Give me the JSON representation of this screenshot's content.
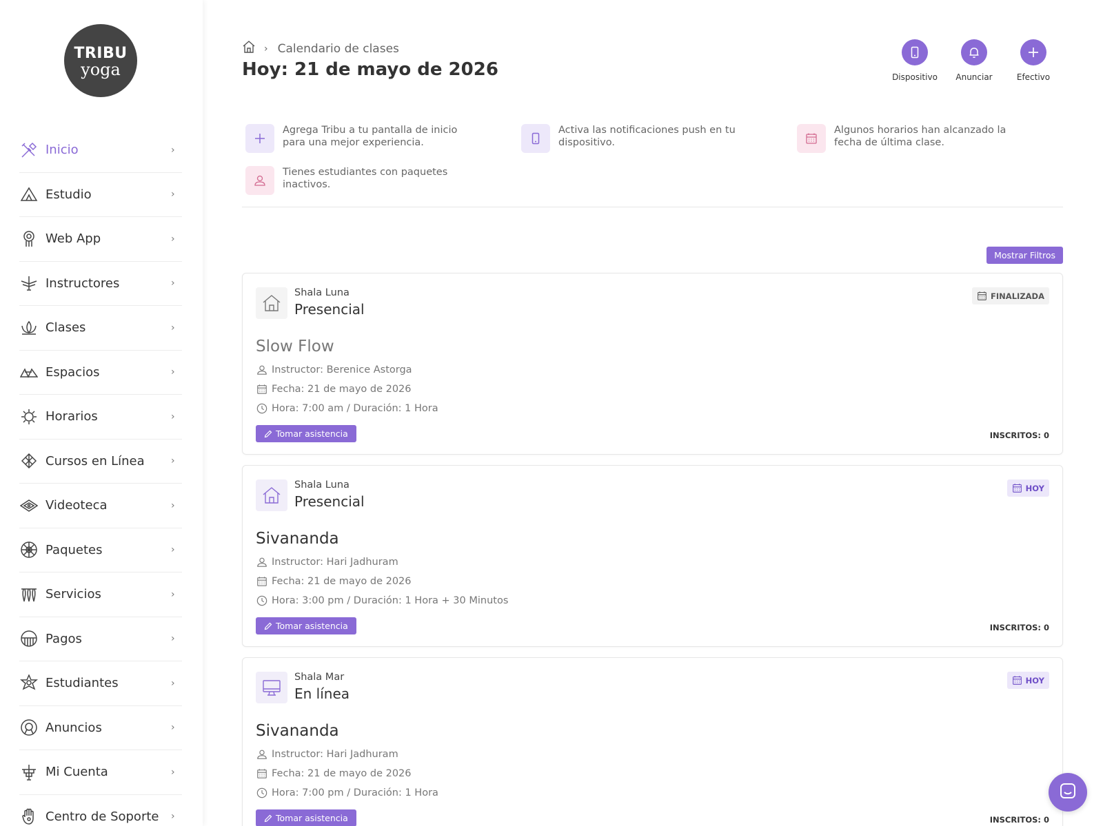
{
  "logo": {
    "line1": "TRIBU",
    "line2": "yoga"
  },
  "sidebar": {
    "items": [
      {
        "label": "Inicio",
        "icon": "sparkle-tools-icon",
        "active": true
      },
      {
        "label": "Estudio",
        "icon": "tent-icon"
      },
      {
        "label": "Web App",
        "icon": "dreamcatcher-icon"
      },
      {
        "label": "Instructores",
        "icon": "eagle-icon"
      },
      {
        "label": "Clases",
        "icon": "lotus-icon"
      },
      {
        "label": "Espacios",
        "icon": "mountains-icon"
      },
      {
        "label": "Horarios",
        "icon": "sun-icon"
      },
      {
        "label": "Cursos en Línea",
        "icon": "leaf-icon"
      },
      {
        "label": "Videoteca",
        "icon": "diamond-eye-icon"
      },
      {
        "label": "Paquetes",
        "icon": "mandala-icon"
      },
      {
        "label": "Servicios",
        "icon": "feathers-icon"
      },
      {
        "label": "Pagos",
        "icon": "half-circle-icon"
      },
      {
        "label": "Estudiantes",
        "icon": "star-person-icon"
      },
      {
        "label": "Anuncios",
        "icon": "circle-face-icon"
      },
      {
        "label": "Mi Cuenta",
        "icon": "totem-icon"
      },
      {
        "label": "Centro de Soporte",
        "icon": "hamsa-icon"
      }
    ]
  },
  "breadcrumb": {
    "current": "Calendario de clases"
  },
  "page_title": "Hoy: 21 de mayo de 2026",
  "actions": [
    {
      "label": "Dispositivo",
      "icon": "phone-icon"
    },
    {
      "label": "Anunciar",
      "icon": "bell-icon"
    },
    {
      "label": "Efectivo",
      "icon": "plus-icon"
    }
  ],
  "notices": [
    {
      "text": "Agrega Tribu a tu pantalla de inicio para una mejor experiencia.",
      "icon": "plus-icon"
    },
    {
      "text": "Activa las notificaciones push en tu dispositivo.",
      "icon": "phone-icon"
    },
    {
      "text": "Algunos horarios han alcanzado la fecha de última clase.",
      "icon": "calendar-icon"
    },
    {
      "text": "Tienes estudiantes con paquetes inactivos.",
      "icon": "user-icon"
    }
  ],
  "filters_button": "Mostrar Filtros",
  "cards": [
    {
      "space": "Shala Luna",
      "modality": "Presencial",
      "name": "Slow Flow",
      "instructor": "Instructor: Berenice Astorga",
      "date": "Fecha: 21 de mayo de 2026",
      "time": "Hora: 7:00 am / Duración: 1 Hora",
      "badge": "FINALIZADA",
      "enrolled": "INSCRITOS: 0",
      "attend": "Tomar asistencia"
    },
    {
      "space": "Shala Luna",
      "modality": "Presencial",
      "name": "Sivananda",
      "instructor": "Instructor: Hari Jadhuram",
      "date": "Fecha: 21 de mayo de 2026",
      "time": "Hora: 3:00 pm / Duración: 1 Hora + 30 Minutos",
      "badge": "HOY",
      "enrolled": "INSCRITOS: 0",
      "attend": "Tomar asistencia"
    },
    {
      "space": "Shala Mar",
      "modality": "En línea",
      "name": "Sivananda",
      "instructor": "Instructor: Hari Jadhuram",
      "date": "Fecha: 21 de mayo de 2026",
      "time": "Hora: 7:00 pm / Duración: 1 Hora",
      "badge": "HOY",
      "enrolled": "INSCRITOS: 0",
      "attend": "Tomar asistencia"
    }
  ],
  "colors": {
    "accent": "#8a6ad6",
    "pink_soft": "#fbe6ee",
    "purple_soft": "#ede8fa"
  }
}
